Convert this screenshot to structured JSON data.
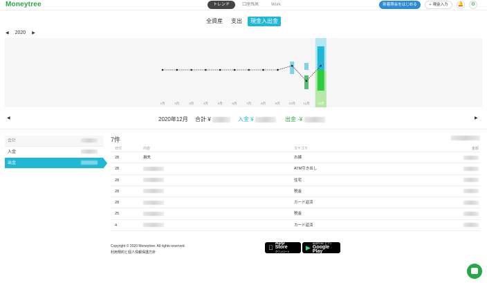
{
  "app": {
    "logo": "Moneytree"
  },
  "nav": {
    "tabs": [
      "トレンド",
      "口座残高",
      "Work"
    ],
    "primary_button": "新着照会をはじめる",
    "cash_button": "現金入力"
  },
  "subtabs": [
    "全資産",
    "支出",
    "現金入出金"
  ],
  "year": "2020",
  "chart_data": {
    "type": "bar",
    "categories": [
      "1月",
      "2月",
      "3月",
      "4月",
      "5月",
      "6月",
      "7月",
      "8月",
      "9月",
      "10月",
      "11月",
      "12月"
    ],
    "series": [
      {
        "values": [
          0,
          0,
          0,
          0,
          0,
          0,
          0,
          0,
          0,
          0,
          0,
          0
        ]
      }
    ],
    "selected_month": "12月",
    "grid": false,
    "colors": {
      "income": "#1fb7d4",
      "expense": "#28a745",
      "line": "#333333",
      "highlight": "#aee6f3"
    }
  },
  "month_summary": {
    "month": "2020年12月",
    "total_label": "合計 ¥",
    "income_label": "入金 ¥",
    "expense_label": "出金 -¥"
  },
  "sidebar": {
    "items": [
      "合計",
      "入金",
      "出金"
    ]
  },
  "table": {
    "count": "7件",
    "headers": [
      "日付",
      "内容",
      "カテゴリ",
      "金額"
    ],
    "rows": [
      {
        "date": "28",
        "desc": "損失",
        "category": "お線"
      },
      {
        "date": "28",
        "desc": "",
        "category": "ATM引き出し"
      },
      {
        "date": "28",
        "desc": "",
        "category": "住宅"
      },
      {
        "date": "28",
        "desc": "",
        "category": "税金"
      },
      {
        "date": "28",
        "desc": "",
        "category": "カード返済"
      },
      {
        "date": "25",
        "desc": "",
        "category": "税金"
      },
      {
        "date": "4",
        "desc": "",
        "category": "カード返済"
      }
    ]
  },
  "footer": {
    "copyright": "Copyright © 2020 Moneytree. All rights reserved.",
    "links": "利用規約と個人情報保護方針",
    "app_store_small": "ダウンロード",
    "app_store": "App Store",
    "play_small": "ANDROID アプリ",
    "play": "Google Play"
  }
}
